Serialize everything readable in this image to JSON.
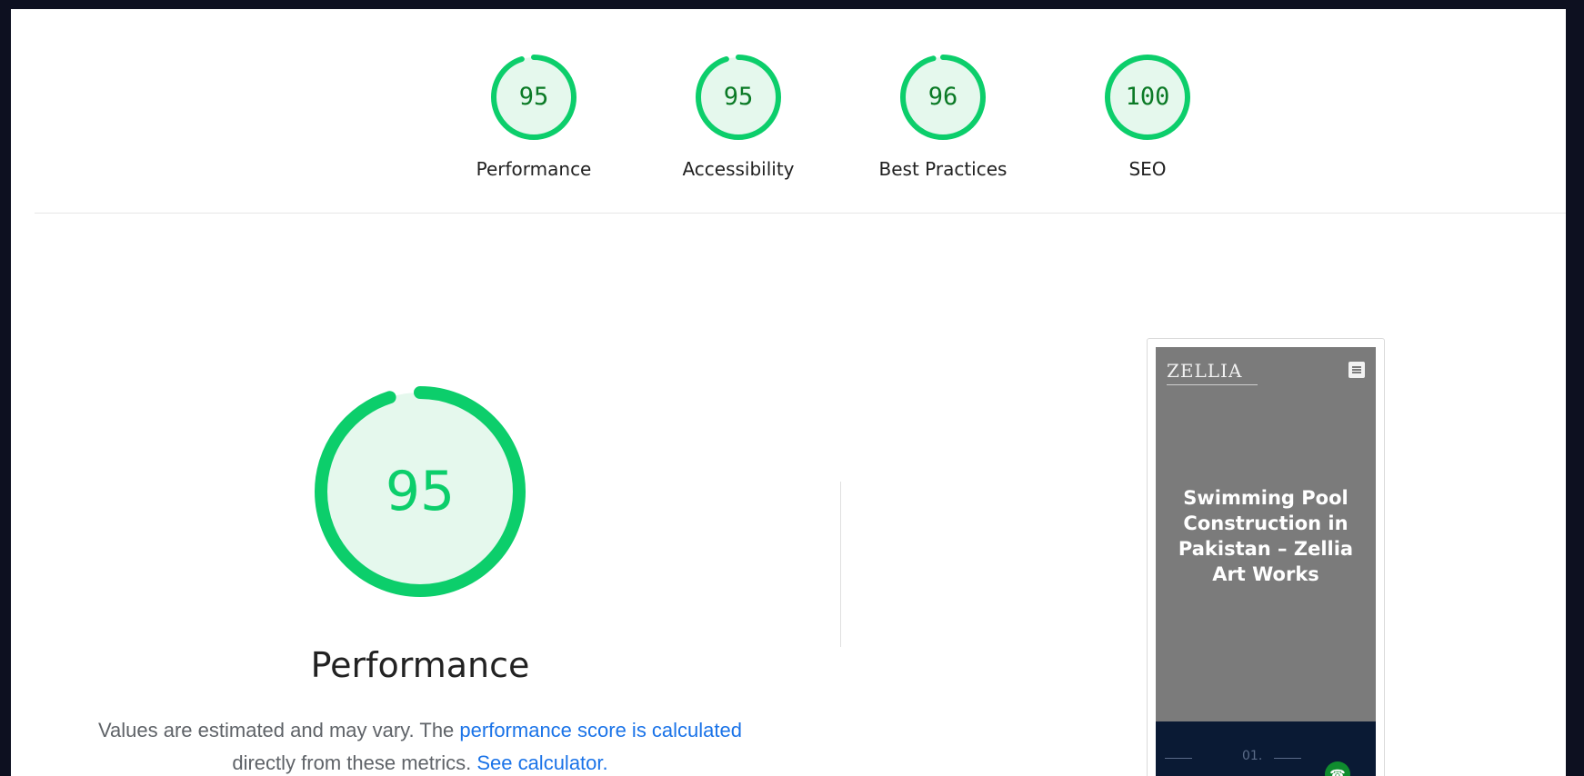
{
  "categories": [
    {
      "score": "95",
      "label": "Performance",
      "fraction": 0.95
    },
    {
      "score": "95",
      "label": "Accessibility",
      "fraction": 0.95
    },
    {
      "score": "96",
      "label": "Best Practices",
      "fraction": 0.96
    },
    {
      "score": "100",
      "label": "SEO",
      "fraction": 1.0
    }
  ],
  "main": {
    "score": "95",
    "fraction": 0.95,
    "title": "Performance",
    "desc_prefix": "Values are estimated and may vary. The ",
    "desc_link1": "performance score is calculated",
    "desc_middle": " directly from these metrics. ",
    "desc_link2": "See calculator."
  },
  "screenshot": {
    "logo": "ZELLIA",
    "heading": "Swimming Pool Construction in Pakistan – Zellia Art Works",
    "bottom_mark": "01."
  },
  "colors": {
    "pass": "#0cce6b",
    "pass_fill": "#e5f8ed",
    "pass_text": "#0b7a26",
    "link": "#1a73e8"
  }
}
